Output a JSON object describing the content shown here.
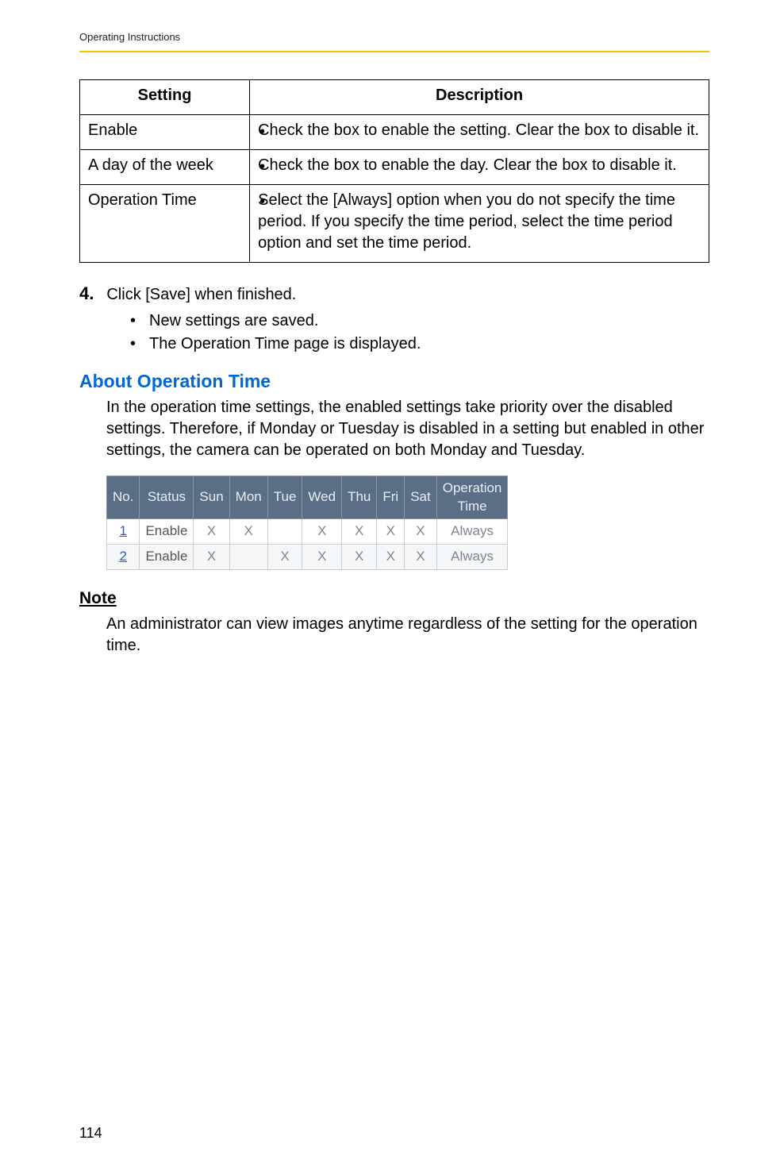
{
  "running_head": "Operating Instructions",
  "settings_table": {
    "headers": {
      "setting": "Setting",
      "description": "Description"
    },
    "rows": [
      {
        "setting": "Enable",
        "description": "Check the box to enable the setting. Clear the box to disable it."
      },
      {
        "setting": "A day of the week",
        "description": "Check the box to enable the day. Clear the box to disable it."
      },
      {
        "setting": "Operation Time",
        "description": "Select the [Always] option when you do not specify the time period. If you specify the time period, select the time period option and set the time period."
      }
    ]
  },
  "step": {
    "number": "4.",
    "text": "Click [Save] when finished.",
    "sub": [
      "New settings are saved.",
      "The Operation Time page is displayed."
    ]
  },
  "section": {
    "heading": "About Operation Time",
    "body": "In the operation time settings, the enabled settings take priority over the disabled settings. Therefore, if Monday or Tuesday is disabled in a setting but enabled in other settings, the camera can be operated on both Monday and Tuesday."
  },
  "example_table": {
    "headers": [
      "No.",
      "Status",
      "Sun",
      "Mon",
      "Tue",
      "Wed",
      "Thu",
      "Fri",
      "Sat",
      "Operation Time"
    ],
    "op_time_line1": "Operation",
    "op_time_line2": "Time",
    "rows": [
      {
        "no": "1",
        "status": "Enable",
        "sun": "X",
        "mon": "X",
        "tue": "",
        "wed": "X",
        "thu": "X",
        "fri": "X",
        "sat": "X",
        "op": "Always"
      },
      {
        "no": "2",
        "status": "Enable",
        "sun": "X",
        "mon": "",
        "tue": "X",
        "wed": "X",
        "thu": "X",
        "fri": "X",
        "sat": "X",
        "op": "Always"
      }
    ]
  },
  "note": {
    "heading": "Note",
    "body": "An administrator can view images anytime regardless of the setting for the operation time."
  },
  "page_number": "114"
}
